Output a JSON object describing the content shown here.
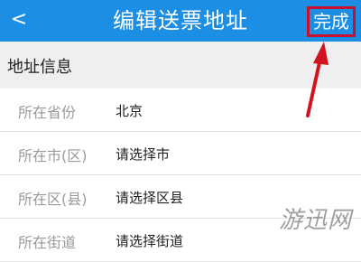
{
  "header": {
    "back_icon": "chevron-left-icon",
    "back_glyph": "<",
    "title": "编辑送票地址",
    "done_label": "完成",
    "bar_color": "#1c8ee3",
    "highlight_color": "#c8102e"
  },
  "section": {
    "title": "地址信息"
  },
  "fields": [
    {
      "label": "所在省份",
      "value": "北京"
    },
    {
      "label": "所在市(区)",
      "value": "请选择市"
    },
    {
      "label": "所在区(县)",
      "value": "请选择区县"
    },
    {
      "label": "所在街道",
      "value": "请选择街道"
    }
  ],
  "annotation": {
    "arrow_icon": "red-arrow-icon",
    "color": "#d0151f"
  },
  "watermark": {
    "text": "游迅网"
  }
}
